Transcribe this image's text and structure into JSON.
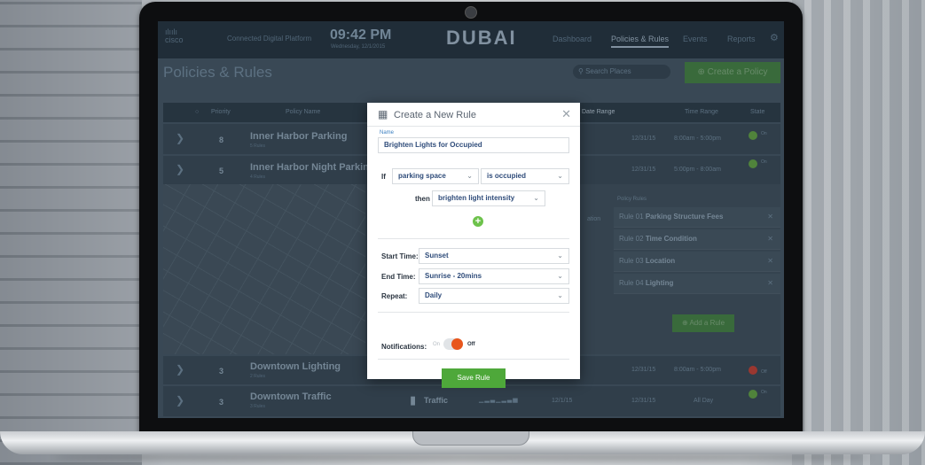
{
  "topbar": {
    "logo": "cisco",
    "app_name": "Connected Digital Platform",
    "time": "09:42 PM",
    "date": "Wednesday, 12/1/2015",
    "brand": "DUBAI",
    "nav": [
      "Dashboard",
      "Policies & Rules",
      "Events",
      "Reports"
    ],
    "active_nav": "Policies & Rules"
  },
  "page": {
    "title": "Policies & Rules",
    "search_placeholder": "Search Places",
    "create_button": "Create a Policy"
  },
  "table": {
    "headers": {
      "priority": "Priority",
      "name": "Policy Name",
      "date_range": "Date Range",
      "time_range": "Time Range",
      "state": "State"
    },
    "rows": [
      {
        "priority": "8",
        "name": "Inner Harbor Parking",
        "sub": "5 Rules",
        "date_end": "12/31/15",
        "time": "8:00am - 5:00pm",
        "state": "On",
        "state_color": "#5e9e3a"
      },
      {
        "priority": "5",
        "name": "Inner Harbor Night Parking",
        "sub": "4 Rules",
        "date_end": "12/31/15",
        "time": "5:00pm - 8:00am",
        "state": "On",
        "state_color": "#5e9e3a"
      },
      {
        "priority": "3",
        "name": "Downtown Lighting",
        "sub": "2 Rules",
        "date_end": "12/31/15",
        "time": "8:00am - 5:00pm",
        "state": "Off",
        "state_color": "#c0392b"
      },
      {
        "priority": "3",
        "name": "Downtown Traffic",
        "sub": "3 Rules",
        "type": "Traffic",
        "date_start": "12/1/15",
        "date_end": "12/31/15",
        "time": "All Day",
        "state": "On",
        "state_color": "#5e9e3a"
      }
    ]
  },
  "expanded": {
    "rules_label": "Policy Rules",
    "partial_label": "ation",
    "rules": [
      {
        "num": "Rule 01",
        "name": "Parking Structure Fees"
      },
      {
        "num": "Rule 02",
        "name": "Time Condition"
      },
      {
        "num": "Rule 03",
        "name": "Location"
      },
      {
        "num": "Rule 04",
        "name": "Lighting"
      }
    ],
    "add_rule": "Add a Rule"
  },
  "modal": {
    "title": "Create a New Rule",
    "name_label": "Name",
    "name_value": "Brighten Lights for Occupied",
    "if_label": "If",
    "if_subject": "parking space",
    "if_condition": "is occupied",
    "then_label": "then",
    "then_action": "brighten light intensity",
    "start_label": "Start Time:",
    "start_value": "Sunset",
    "end_label": "End Time:",
    "end_value": "Sunrise - 20mins",
    "repeat_label": "Repeat:",
    "repeat_value": "Daily",
    "notifications_label": "Notifications:",
    "toggle_on": "On",
    "toggle_off": "Off",
    "notifications_enabled": false,
    "save": "Save Rule"
  }
}
